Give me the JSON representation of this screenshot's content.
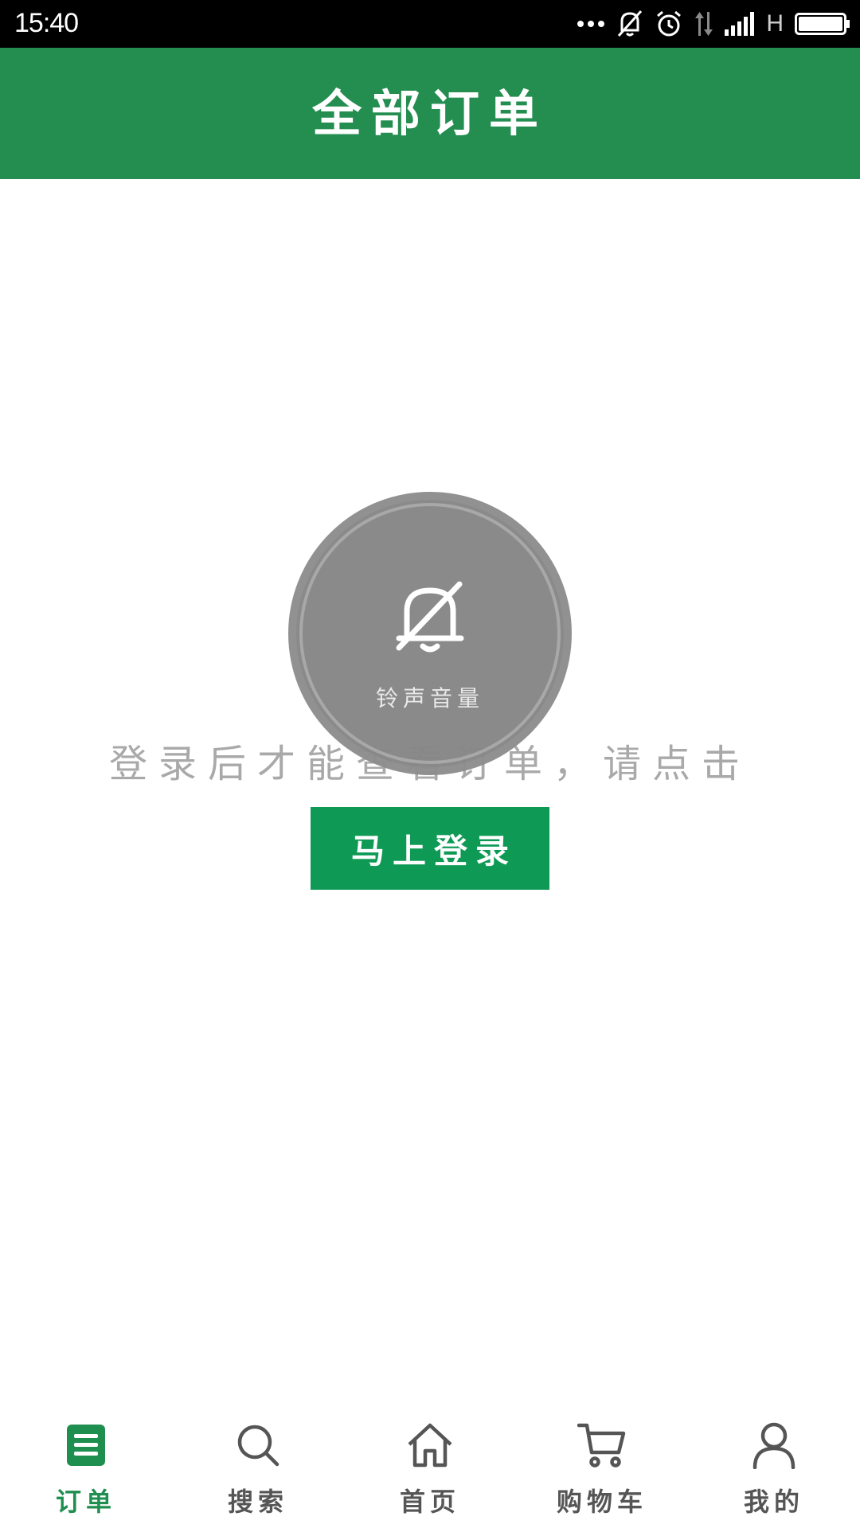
{
  "status_bar": {
    "time": "15:40",
    "network_type": "H",
    "icons": [
      "more-dots-icon",
      "bell-off-icon",
      "alarm-icon",
      "data-arrows-icon",
      "signal-icon",
      "battery-icon"
    ]
  },
  "header": {
    "title": "全部订单"
  },
  "main": {
    "prompt": "登录后才能查看订单，请点击",
    "login_button": "马上登录"
  },
  "volume_overlay": {
    "label": "铃声音量",
    "icon": "bell-off-icon"
  },
  "bottom_nav": {
    "items": [
      {
        "label": "订单",
        "icon": "order-list-icon",
        "active": true
      },
      {
        "label": "搜索",
        "icon": "search-icon",
        "active": false
      },
      {
        "label": "首页",
        "icon": "home-icon",
        "active": false
      },
      {
        "label": "购物车",
        "icon": "cart-icon",
        "active": false
      },
      {
        "label": "我的",
        "icon": "user-icon",
        "active": false
      }
    ]
  },
  "colors": {
    "brand_green": "#238e50",
    "button_green": "#0e9a55",
    "active_nav": "#1f8f4f",
    "inactive_nav": "#555555"
  }
}
